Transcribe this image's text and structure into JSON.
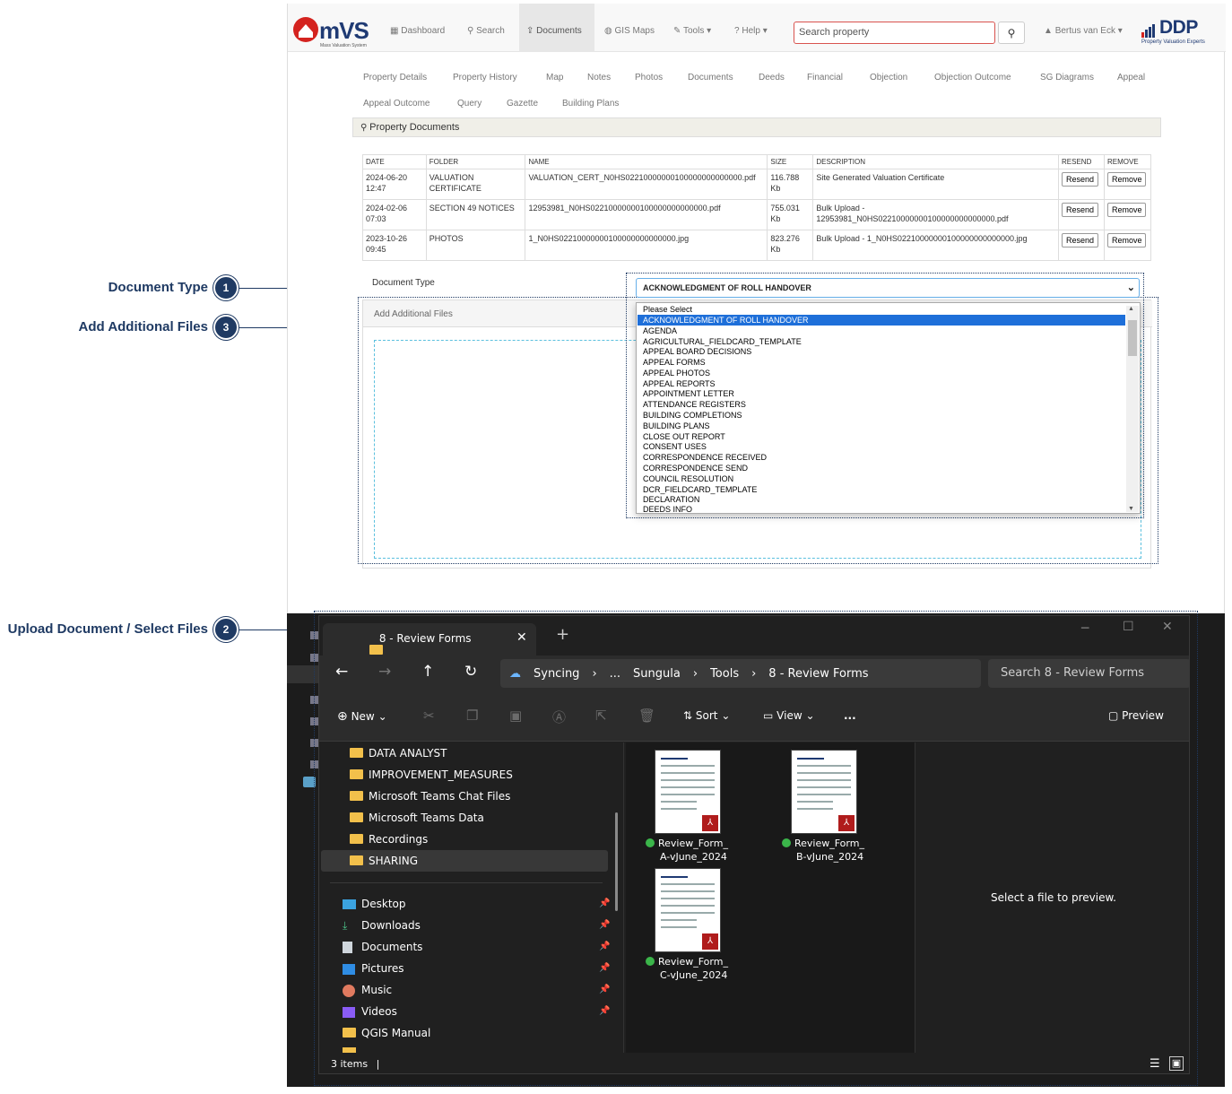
{
  "callouts": [
    {
      "label": "Document Type",
      "number": "1"
    },
    {
      "label": "Add Additional Files",
      "number": "3"
    },
    {
      "label": "Upload Document / Select Files",
      "number": "2"
    }
  ],
  "header": {
    "logo_text": "mVS",
    "logo_subtitle": "Mass Valuation System",
    "nav": [
      "Dashboard",
      "Search",
      "Documents",
      "GIS Maps",
      "Tools",
      "Help"
    ],
    "search_placeholder": "Search property",
    "user": "Bertus van Eck",
    "brand": "DDP",
    "brand_tagline": "Property Valuation Experts"
  },
  "subtabs": [
    "Property Details",
    "Property History",
    "Map",
    "Notes",
    "Photos",
    "Documents",
    "Deeds",
    "Financial",
    "Objection",
    "Objection Outcome",
    "SG Diagrams",
    "Appeal",
    "Appeal Outcome",
    "Query",
    "Gazette",
    "Building Plans"
  ],
  "panel_title": "Property Documents",
  "table": {
    "headers": [
      "DATE",
      "FOLDER",
      "NAME",
      "SIZE",
      "DESCRIPTION",
      "RESEND",
      "REMOVE"
    ],
    "rows": [
      {
        "date": "2024-06-20 12:47",
        "folder": "VALUATION CERTIFICATE",
        "name": "VALUATION_CERT_N0HS02210000000100000000000000.pdf",
        "size": "116.788 Kb",
        "description": "Site Generated Valuation Certificate",
        "resend": "Resend",
        "remove": "Remove"
      },
      {
        "date": "2024-02-06 07:03",
        "folder": "SECTION 49 NOTICES",
        "name": "12953981_N0HS02210000000100000000000000.pdf",
        "size": "755.031 Kb",
        "description": "Bulk Upload - 12953981_N0HS02210000000100000000000000.pdf",
        "resend": "Resend",
        "remove": "Remove"
      },
      {
        "date": "2023-10-26 09:45",
        "folder": "PHOTOS",
        "name": "1_N0HS02210000000100000000000000.jpg",
        "size": "823.276 Kb",
        "description": "Bulk Upload - 1_N0HS02210000000100000000000000.jpg",
        "resend": "Resend",
        "remove": "Remove"
      }
    ]
  },
  "document_type": {
    "label": "Document Type",
    "selected": "ACKNOWLEDGMENT OF ROLL HANDOVER",
    "options": [
      "Please Select",
      "ACKNOWLEDGMENT OF ROLL HANDOVER",
      "AGENDA",
      "AGRICULTURAL_FIELDCARD_TEMPLATE",
      "APPEAL BOARD DECISIONS",
      "APPEAL FORMS",
      "APPEAL PHOTOS",
      "APPEAL REPORTS",
      "APPOINTMENT LETTER",
      "ATTENDANCE REGISTERS",
      "BUILDING COMPLETIONS",
      "BUILDING PLANS",
      "CLOSE OUT REPORT",
      "CONSENT USES",
      "CORRESPONDENCE RECEIVED",
      "CORRESPONDENCE SEND",
      "COUNCIL RESOLUTION",
      "DCR_FIELDCARD_TEMPLATE",
      "DECLARATION",
      "DEEDS INFO"
    ]
  },
  "add_files_label": "Add Additional Files",
  "explorer": {
    "tab_title": "8 - Review Forms",
    "breadcrumbs": [
      "Syncing",
      "...",
      "Sungula",
      "Tools",
      "8 - Review Forms"
    ],
    "search_placeholder": "Search 8 - Review Forms",
    "commands": {
      "new": "New",
      "sort": "Sort",
      "view": "View",
      "more": "...",
      "preview": "Preview"
    },
    "folders": [
      "DATA ANALYST",
      "IMPROVEMENT_MEASURES",
      "Microsoft Teams Chat Files",
      "Microsoft Teams Data",
      "Recordings",
      "SHARING"
    ],
    "quick_access": [
      "Desktop",
      "Downloads",
      "Documents",
      "Pictures",
      "Music",
      "Videos",
      "QGIS Manual"
    ],
    "files": [
      {
        "line1": "Review_Form_",
        "line2": "A-vJune_2024"
      },
      {
        "line1": "Review_Form_",
        "line2": "B-vJune_2024"
      },
      {
        "line1": "Review_Form_",
        "line2": "C-vJune_2024"
      }
    ],
    "preview_text": "Select a file to preview.",
    "status": "3 items"
  },
  "colors": {
    "callout": "#1f3a63",
    "selection": "#1e6fd9",
    "search_border": "#d9534f"
  }
}
